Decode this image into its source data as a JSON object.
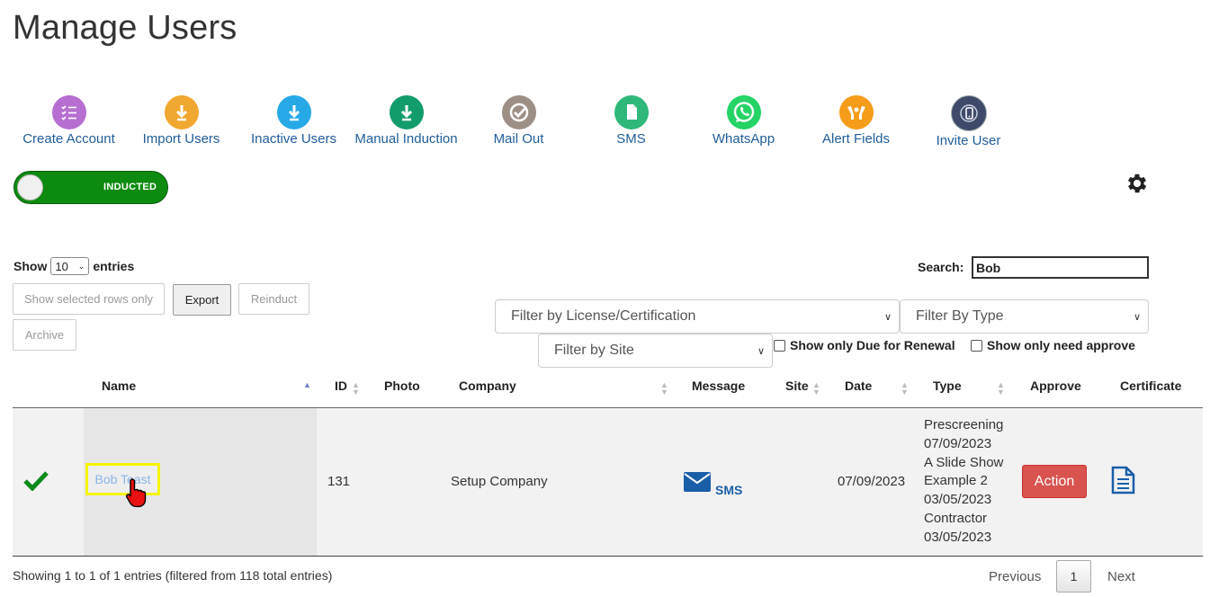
{
  "page": {
    "title": "Manage Users"
  },
  "toolbar": {
    "items": [
      {
        "label": "Create Account",
        "icon": "list-checks-icon",
        "color": "#b66fd0"
      },
      {
        "label": "Import Users",
        "icon": "download-arrow-icon",
        "color": "#f0a830"
      },
      {
        "label": "Inactive Users",
        "icon": "download-arrow-icon",
        "color": "#27a9e8"
      },
      {
        "label": "Manual Induction",
        "icon": "download-arrow-icon",
        "color": "#139c6b"
      },
      {
        "label": "Mail Out",
        "icon": "check-circle-icon",
        "color": "#9e8f86"
      },
      {
        "label": "SMS",
        "icon": "document-icon",
        "color": "#2fb87a"
      },
      {
        "label": "WhatsApp",
        "icon": "whatsapp-icon",
        "color": "#25d366"
      },
      {
        "label": "Alert Fields",
        "icon": "hands-icon",
        "color": "#f59c1a"
      },
      {
        "label": "Invite User",
        "icon": "phone-icon",
        "color": "#3f4a6a"
      }
    ]
  },
  "toggle": {
    "label": "INDUCTED"
  },
  "icons": {
    "settings": "gear-icon",
    "approved": "checkmark-icon",
    "message": "envelope-icon",
    "certificate": "document-icon",
    "cursor": "hand-cursor-icon"
  },
  "controls": {
    "show_label": "Show",
    "entries_value": "10",
    "entries_label": "entries",
    "search_label": "Search:",
    "search_value": "Bob",
    "buttons": {
      "show_selected": "Show selected rows only",
      "export": "Export",
      "reinduct": "Reinduct",
      "archive": "Archive"
    },
    "filters": {
      "license": "Filter by License/Certification",
      "type": "Filter By Type",
      "site": "Filter by Site"
    },
    "checkboxes": {
      "due_renewal": "Show only Due for Renewal",
      "need_approve": "Show only need approve"
    }
  },
  "table": {
    "headers": {
      "name": "Name",
      "id": "ID",
      "photo": "Photo",
      "company": "Company",
      "message": "Message",
      "site": "Site",
      "date": "Date",
      "type": "Type",
      "approve": "Approve",
      "certificate": "Certificate"
    },
    "rows": [
      {
        "name": "Bob Teast",
        "id": "131",
        "company": "Setup Company",
        "message": "SMS",
        "date": "07/09/2023",
        "type_lines": [
          "Prescreening",
          "07/09/2023",
          "A Slide Show",
          "Example 2",
          "03/05/2023",
          "Contractor",
          "03/05/2023"
        ],
        "approve": "Action"
      }
    ]
  },
  "footer": {
    "info": "Showing 1 to 1 of 1 entries (filtered from 118 total entries)",
    "previous": "Previous",
    "page": "1",
    "next": "Next"
  }
}
